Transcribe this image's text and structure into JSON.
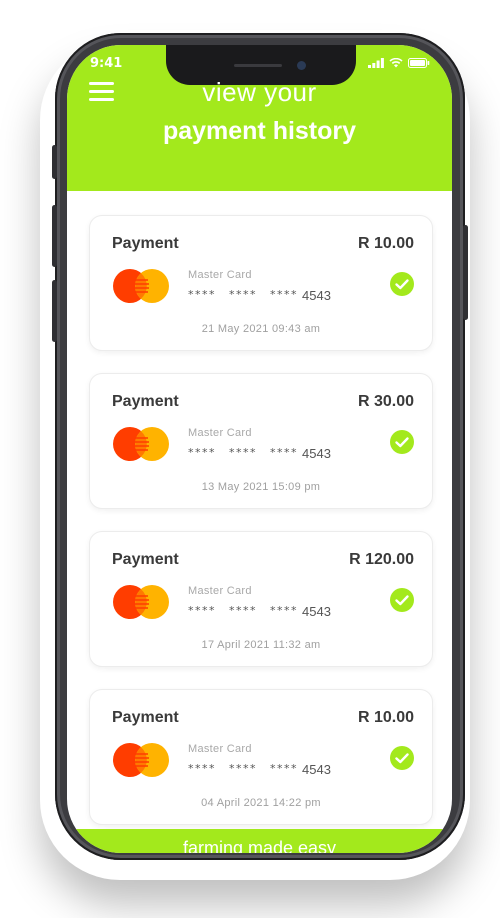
{
  "status_bar": {
    "time": "9:41"
  },
  "header": {
    "title_line1": "view your",
    "title_line2": "payment history",
    "accent_color": "#a3e91c"
  },
  "payments": [
    {
      "title": "Payment",
      "amount": "R 10.00",
      "card_brand": "Master Card",
      "masked": "**** **** ****",
      "last4": "4543",
      "date": "21 May 2021 09:43 am",
      "status_icon": "check-circle-icon"
    },
    {
      "title": "Payment",
      "amount": "R 30.00",
      "card_brand": "Master Card",
      "masked": "**** **** ****",
      "last4": "4543",
      "date": "13 May 2021 15:09 pm",
      "status_icon": "check-circle-icon"
    },
    {
      "title": "Payment",
      "amount": "R 120.00",
      "card_brand": "Master Card",
      "masked": "**** **** ****",
      "last4": "4543",
      "date": "17 April 2021 11:32 am",
      "status_icon": "check-circle-icon"
    },
    {
      "title": "Payment",
      "amount": "R 10.00",
      "card_brand": "Master Card",
      "masked": "**** **** ****",
      "last4": "4543",
      "date": "04 April 2021 14:22 pm",
      "status_icon": "check-circle-icon"
    }
  ],
  "footer": {
    "tagline": "farming made easy"
  }
}
